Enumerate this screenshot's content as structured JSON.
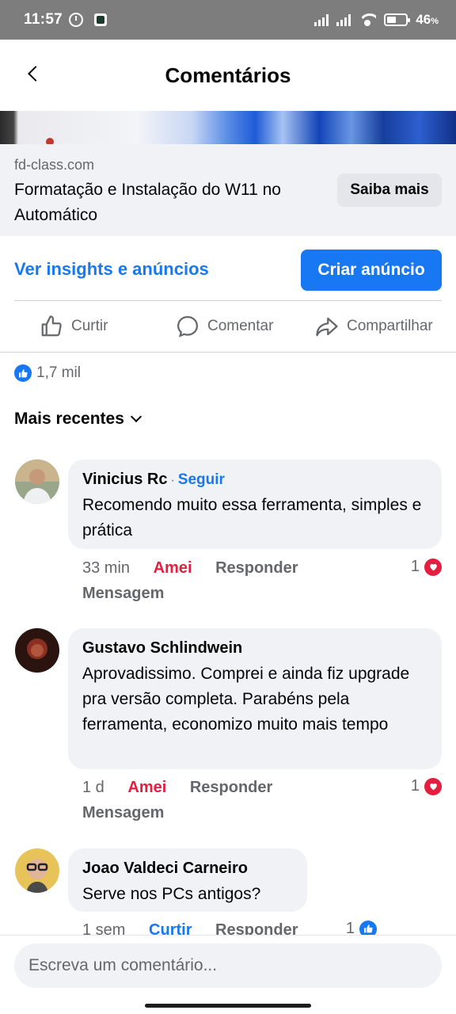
{
  "status_bar": {
    "time": "11:57",
    "battery": "46",
    "battery_unit": "%"
  },
  "header": {
    "title": "Comentários"
  },
  "ad": {
    "domain": "fd-class.com",
    "headline": "Formatação e Instalação do W11 no Automático",
    "cta": "Saiba mais"
  },
  "promo": {
    "insights_link": "Ver insights e anúncios",
    "create_ad": "Criar anúncio"
  },
  "actions": {
    "like": "Curtir",
    "comment": "Comentar",
    "share": "Compartilhar"
  },
  "reactions": {
    "count": "1,7 mil"
  },
  "sort": {
    "label": "Mais recentes"
  },
  "comments": [
    {
      "author": "Vinicius Rc",
      "follow": "Seguir",
      "text": "Recomendo muito essa ferramenta, simples e prática",
      "time": "33 min",
      "reaction_label": "Amei",
      "reply": "Responder",
      "message": "Mensagem",
      "reaction_count": "1"
    },
    {
      "author": "Gustavo Schlindwein",
      "text": "Aprovadissimo. Comprei e ainda fiz upgrade pra versão completa. Parabéns pela ferramenta, economizo muito mais tempo",
      "time": "1 d",
      "reaction_label": "Amei",
      "reply": "Responder",
      "message": "Mensagem",
      "reaction_count": "1"
    },
    {
      "author": "Joao Valdeci Carneiro",
      "text": "Serve nos PCs antigos?",
      "time": "1 sem",
      "reaction_label": "Curtir",
      "reply": "Responder",
      "reaction_count": "1"
    }
  ],
  "composer": {
    "placeholder": "Escreva um comentário..."
  },
  "colors": {
    "accent": "#1877f2",
    "love": "#e41e3f",
    "bubble": "#f0f2f5",
    "muted": "#65676b"
  }
}
